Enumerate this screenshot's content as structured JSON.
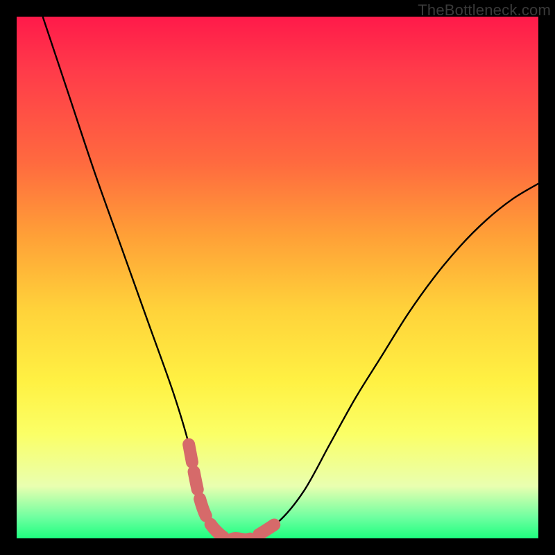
{
  "watermark": "TheBottleneck.com",
  "colors": {
    "background": "#000000",
    "curve": "#000000",
    "highlight": "#d66a6a"
  },
  "chart_data": {
    "type": "line",
    "title": "",
    "xlabel": "",
    "ylabel": "",
    "xlim": [
      0,
      100
    ],
    "ylim": [
      0,
      100
    ],
    "grid": false,
    "legend": false,
    "series": [
      {
        "name": "bottleneck-curve",
        "x": [
          5,
          10,
          15,
          20,
          25,
          30,
          33,
          35,
          37,
          40,
          42,
          45,
          50,
          55,
          60,
          65,
          70,
          75,
          80,
          85,
          90,
          95,
          100
        ],
        "y": [
          100,
          85,
          70,
          56,
          42,
          28,
          18,
          8,
          3,
          0,
          0,
          0,
          3,
          9,
          18,
          27,
          35,
          43,
          50,
          56,
          61,
          65,
          68
        ]
      }
    ],
    "annotations": [
      {
        "name": "valley-highlight",
        "type": "segment-highlight",
        "x_range": [
          31,
          52
        ],
        "note": "thick reddish dashed emphasis around the minimum"
      }
    ]
  }
}
